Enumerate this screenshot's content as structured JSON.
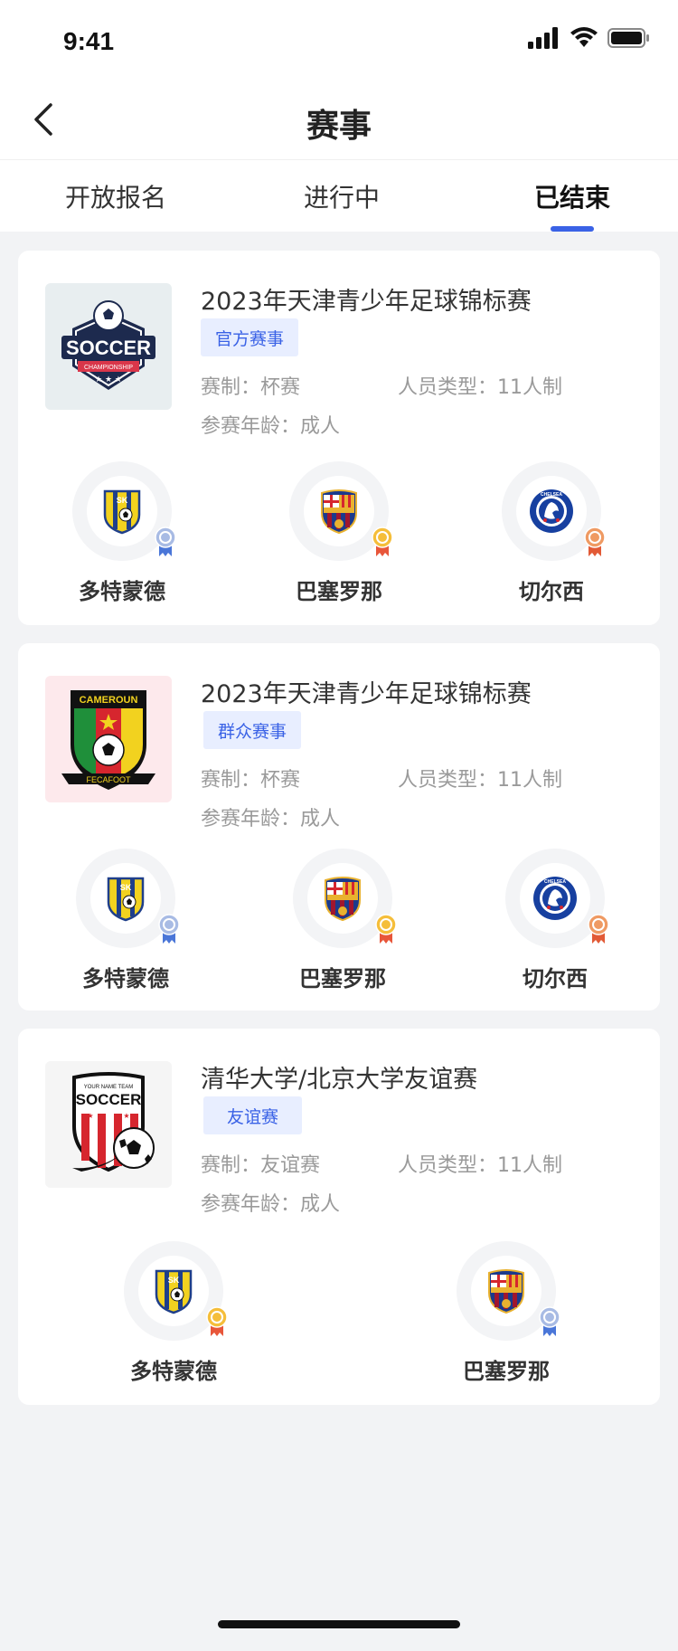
{
  "status": {
    "time": "9:41"
  },
  "nav": {
    "title": "赛事"
  },
  "tabs": [
    {
      "label": "开放报名"
    },
    {
      "label": "进行中"
    },
    {
      "label": "已结束"
    }
  ],
  "colors": {
    "accent": "#3a62e6",
    "gold": "#f2b233",
    "silver": "#8ea6d8",
    "bronze": "#e58f55"
  },
  "cards": [
    {
      "title": "2023年天津青少年足球锦标赛",
      "tag": "官方赛事",
      "format": "赛制：杯赛",
      "people": "人员类型：11人制",
      "age": "参赛年龄：成人",
      "logo_text": "SOCCER",
      "logo_sub": "CHAMPIONSHIP",
      "teams": [
        {
          "name": "多特蒙德",
          "medal": "silver",
          "crest": "SK"
        },
        {
          "name": "巴塞罗那",
          "medal": "gold",
          "crest": "FCB"
        },
        {
          "name": "切尔西",
          "medal": "bronze",
          "crest": "CHELSEA"
        }
      ]
    },
    {
      "title": "2023年天津青少年足球锦标赛",
      "tag": "群众赛事",
      "format": "赛制：杯赛",
      "people": "人员类型：11人制",
      "age": "参赛年龄：成人",
      "logo_text": "CAMEROUN",
      "logo_sub": "FECAFOOT",
      "teams": [
        {
          "name": "多特蒙德",
          "medal": "silver",
          "crest": "SK"
        },
        {
          "name": "巴塞罗那",
          "medal": "gold",
          "crest": "FCB"
        },
        {
          "name": "切尔西",
          "medal": "bronze",
          "crest": "CHELSEA"
        }
      ]
    },
    {
      "title": "清华大学/北京大学友谊赛",
      "tag": "友谊赛",
      "format": "赛制：友谊赛",
      "people": "人员类型：11人制",
      "age": "参赛年龄：成人",
      "logo_text": "SOCCER",
      "logo_sub": "YOUR NAME TEAM",
      "teams": [
        {
          "name": "多特蒙德",
          "medal": "gold",
          "crest": "SK"
        },
        {
          "name": "巴塞罗那",
          "medal": "silver",
          "crest": "FCB"
        }
      ]
    }
  ]
}
